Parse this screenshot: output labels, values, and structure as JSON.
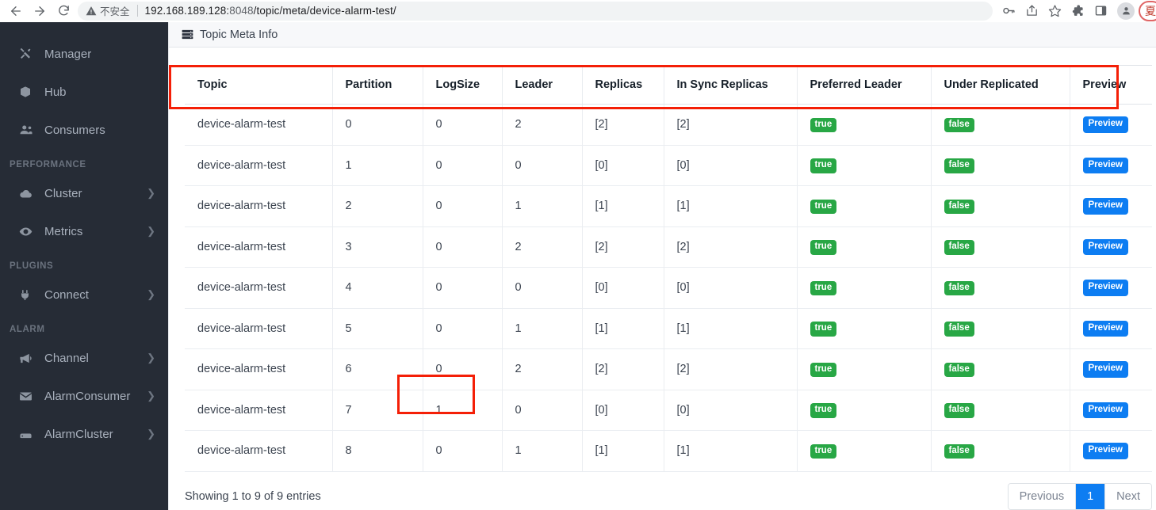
{
  "browser": {
    "back_icon": "arrow-left-icon",
    "forward_icon": "arrow-right-icon",
    "reload_icon": "reload-icon",
    "warning_icon": "warning-triangle-icon",
    "insecure_label": "不安全",
    "url_host": "192.168.189.128:",
    "url_port": "8048",
    "url_path": "/topic/meta/device-alarm-test/",
    "url_full": "192.168.189.128:8048/topic/meta/device-alarm-test/",
    "right_icons": [
      "key-icon",
      "share-icon",
      "star-icon",
      "extensions-icon",
      "side-panel-icon",
      "profile-avatar-icon"
    ],
    "profile_initial": "夏"
  },
  "sidebar": {
    "items": [
      {
        "label": "Manager",
        "icon": "tools-icon",
        "has_chevron": false,
        "type": "item"
      },
      {
        "label": "Hub",
        "icon": "cube-icon",
        "has_chevron": false,
        "type": "item"
      },
      {
        "label": "Consumers",
        "icon": "users-icon",
        "has_chevron": false,
        "type": "item"
      },
      {
        "label": "PERFORMANCE",
        "type": "section"
      },
      {
        "label": "Cluster",
        "icon": "cloud-icon",
        "has_chevron": true,
        "type": "item"
      },
      {
        "label": "Metrics",
        "icon": "eye-icon",
        "has_chevron": true,
        "type": "item"
      },
      {
        "label": "PLUGINS",
        "type": "section"
      },
      {
        "label": "Connect",
        "icon": "plug-icon",
        "has_chevron": true,
        "type": "item"
      },
      {
        "label": "ALARM",
        "type": "section"
      },
      {
        "label": "Channel",
        "icon": "bullhorn-icon",
        "has_chevron": true,
        "type": "item"
      },
      {
        "label": "AlarmConsumer",
        "icon": "envelope-icon",
        "has_chevron": true,
        "type": "item"
      },
      {
        "label": "AlarmCluster",
        "icon": "server-icon",
        "has_chevron": true,
        "type": "item"
      }
    ]
  },
  "card": {
    "title": "Topic Meta Info",
    "icon": "server-rack-icon"
  },
  "table": {
    "columns": [
      "Topic",
      "Partition",
      "LogSize",
      "Leader",
      "Replicas",
      "In Sync Replicas",
      "Preferred Leader",
      "Under Replicated",
      "Preview"
    ],
    "rows": [
      {
        "topic": "device-alarm-test",
        "partition": "0",
        "logsize": "0",
        "leader": "2",
        "replicas": "[2]",
        "isr": "[2]",
        "preferred_leader": "true",
        "under_replicated": "false",
        "preview": "Preview"
      },
      {
        "topic": "device-alarm-test",
        "partition": "1",
        "logsize": "0",
        "leader": "0",
        "replicas": "[0]",
        "isr": "[0]",
        "preferred_leader": "true",
        "under_replicated": "false",
        "preview": "Preview"
      },
      {
        "topic": "device-alarm-test",
        "partition": "2",
        "logsize": "0",
        "leader": "1",
        "replicas": "[1]",
        "isr": "[1]",
        "preferred_leader": "true",
        "under_replicated": "false",
        "preview": "Preview"
      },
      {
        "topic": "device-alarm-test",
        "partition": "3",
        "logsize": "0",
        "leader": "2",
        "replicas": "[2]",
        "isr": "[2]",
        "preferred_leader": "true",
        "under_replicated": "false",
        "preview": "Preview"
      },
      {
        "topic": "device-alarm-test",
        "partition": "4",
        "logsize": "0",
        "leader": "0",
        "replicas": "[0]",
        "isr": "[0]",
        "preferred_leader": "true",
        "under_replicated": "false",
        "preview": "Preview"
      },
      {
        "topic": "device-alarm-test",
        "partition": "5",
        "logsize": "0",
        "leader": "1",
        "replicas": "[1]",
        "isr": "[1]",
        "preferred_leader": "true",
        "under_replicated": "false",
        "preview": "Preview"
      },
      {
        "topic": "device-alarm-test",
        "partition": "6",
        "logsize": "0",
        "leader": "2",
        "replicas": "[2]",
        "isr": "[2]",
        "preferred_leader": "true",
        "under_replicated": "false",
        "preview": "Preview"
      },
      {
        "topic": "device-alarm-test",
        "partition": "7",
        "logsize": "1",
        "leader": "0",
        "replicas": "[0]",
        "isr": "[0]",
        "preferred_leader": "true",
        "under_replicated": "false",
        "preview": "Preview"
      },
      {
        "topic": "device-alarm-test",
        "partition": "8",
        "logsize": "0",
        "leader": "1",
        "replicas": "[1]",
        "isr": "[1]",
        "preferred_leader": "true",
        "under_replicated": "false",
        "preview": "Preview"
      }
    ]
  },
  "footer": {
    "showing": "Showing 1 to 9 of 9 entries",
    "previous": "Previous",
    "page_number": "1",
    "next": "Next"
  },
  "annotations": {
    "header_box": "red-rectangle-around-table-header",
    "cell_box": "red-rectangle-around-logsize-row7"
  },
  "colors": {
    "sidebar_bg": "#262c36",
    "badge_green": "#28a745",
    "button_blue": "#0d7df2",
    "annotation_red": "#f41f07"
  }
}
